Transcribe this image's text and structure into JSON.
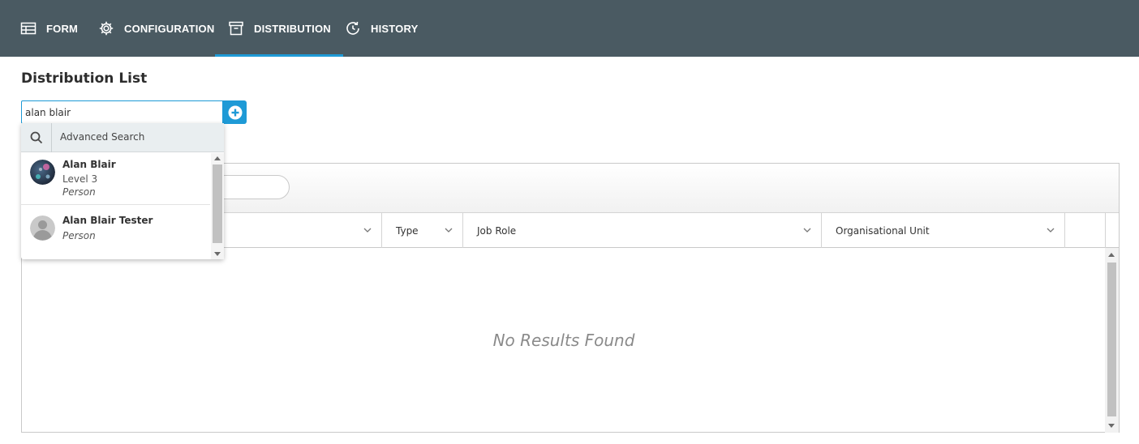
{
  "nav": {
    "tabs": [
      {
        "label": "FORM",
        "icon": "table-icon"
      },
      {
        "label": "CONFIGURATION",
        "icon": "gear-icon"
      },
      {
        "label": "DISTRIBUTION",
        "icon": "archive-box-icon",
        "active": true
      },
      {
        "label": "HISTORY",
        "icon": "history-clock-icon"
      }
    ]
  },
  "page": {
    "title": "Distribution List"
  },
  "search": {
    "value": "alan blair"
  },
  "dropdown": {
    "advanced_label": "Advanced Search",
    "results": [
      {
        "name": "Alan Blair",
        "level": "Level 3",
        "type": "Person"
      },
      {
        "name": "Alan Blair Tester",
        "type": "Person"
      }
    ]
  },
  "grid": {
    "columns": [
      "Type",
      "Job Role",
      "Organisational Unit"
    ],
    "empty_message": "No Results Found"
  },
  "colors": {
    "nav_bg": "#4a5a62",
    "accent": "#1e9ad6"
  }
}
